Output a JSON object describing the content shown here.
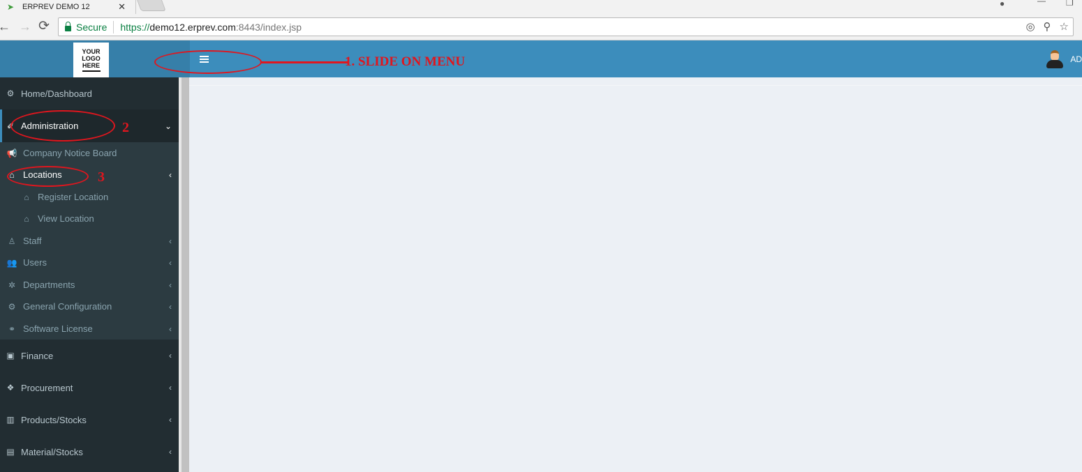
{
  "browser": {
    "tab_title": "ERPREV DEMO 12",
    "secure_label": "Secure",
    "url_protocol": "https://",
    "url_host": "demo12.erprev.com",
    "url_rest": ":8443/index.jsp",
    "icons": {
      "back": "←",
      "forward": "→",
      "reload": "⟳",
      "close_tab": "✕",
      "location": "◎",
      "key": "⚲",
      "star": "☆",
      "profile": "●",
      "minimize": "—",
      "restore": "❐"
    }
  },
  "header": {
    "logo_lines": [
      "YOUR",
      "LOGO",
      "HERE"
    ],
    "menu_toggle_icon": "hamburger-icon",
    "user_label": "AD",
    "brand_color": "#3c8dbc"
  },
  "sidebar": {
    "items": [
      {
        "label": "Home/Dashboard",
        "icon": "⚙",
        "chevron": ""
      },
      {
        "label": "Administration",
        "icon": "✐",
        "chevron": "⌄",
        "expanded": true
      },
      {
        "label": "Finance",
        "icon": "▣",
        "chevron": "‹"
      },
      {
        "label": "Procurement",
        "icon": "❖",
        "chevron": "‹"
      },
      {
        "label": "Products/Stocks",
        "icon": "▥",
        "chevron": "‹"
      },
      {
        "label": "Material/Stocks",
        "icon": "▤",
        "chevron": "‹"
      }
    ],
    "admin_submenu": [
      {
        "label": "Company Notice Board",
        "icon": "📢",
        "chevron": ""
      },
      {
        "label": "Locations",
        "icon": "⌂",
        "chevron": "‹",
        "expanded": true
      },
      {
        "label": "Register Location",
        "icon": "⌂",
        "chevron": ""
      },
      {
        "label": "View Location",
        "icon": "⌂",
        "chevron": ""
      },
      {
        "label": "Staff",
        "icon": "♙",
        "chevron": "‹"
      },
      {
        "label": "Users",
        "icon": "👥",
        "chevron": "‹"
      },
      {
        "label": "Departments",
        "icon": "✲",
        "chevron": "‹"
      },
      {
        "label": "General Configuration",
        "icon": "⚙",
        "chevron": "‹"
      },
      {
        "label": "Software License",
        "icon": "⚭",
        "chevron": "‹"
      }
    ]
  },
  "annotations": {
    "step1": "1.  SLIDE ON MENU",
    "step2": "2",
    "step3": "3",
    "color": "#e0161e"
  }
}
